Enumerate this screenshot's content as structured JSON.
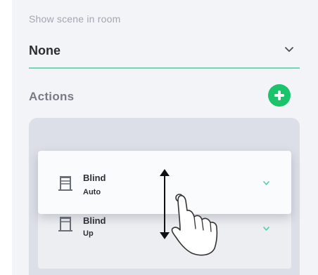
{
  "scene_setting": {
    "label": "Show scene in room",
    "value": "None"
  },
  "actions_section": {
    "title": "Actions",
    "items": [
      {
        "title": "Blind",
        "subtitle": "Auto"
      },
      {
        "title": "Blind",
        "subtitle": "Up"
      }
    ]
  },
  "colors": {
    "accent_green": "#1bc46b",
    "underline_green": "#6fd8b2",
    "chevron_green": "#4fd2a0"
  },
  "icons": {
    "select": "chevron-down-icon",
    "add": "plus-circle-icon",
    "item": "blind-icon",
    "item_expand": "chevron-down-icon",
    "gesture": "hand-pointer-icon",
    "drag_hint": "vertical-double-arrow-icon"
  }
}
